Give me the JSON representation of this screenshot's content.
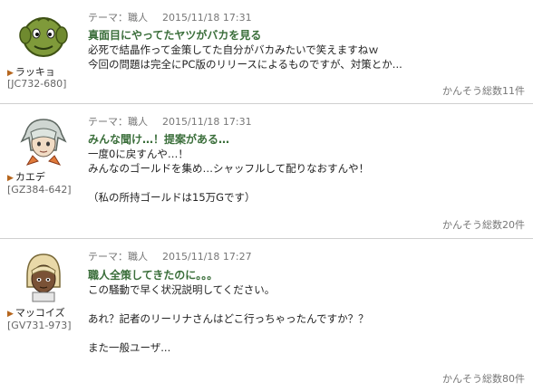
{
  "posts": [
    {
      "user": "ラッキョ",
      "user_id": "[JC732-680]",
      "theme": "テーマ：職人",
      "datetime": "2015/11/18 17:31",
      "title": "真面目にやってたヤツがバカを見る",
      "body": [
        "必死で結晶作って金策してた自分がバカみたいで笑えますねｗ",
        "今回の問題は完全にPC版のリリースによるものですが、対策とか..."
      ],
      "reply_count": "かんそう総数11件",
      "avatar_icon": "green-goblin-avatar-icon"
    },
    {
      "user": "カエデ",
      "user_id": "[GZ384-642]",
      "theme": "テーマ：職人",
      "datetime": "2015/11/18 17:31",
      "title": "みんな聞け…！提案がある…",
      "body": [
        "一度0に戻すんや…！",
        "みんなのゴールドを集め…シャッフルして配りなおすんや！",
        "",
        "（私の所持ゴールドは15万Gです）"
      ],
      "reply_count": "かんそう総数20件",
      "avatar_icon": "silver-hair-elf-avatar-icon"
    },
    {
      "user": "マッコイズ",
      "user_id": "[GV731-973]",
      "theme": "テーマ：職人",
      "datetime": "2015/11/18 17:27",
      "title": "職人全策してきたのに。。。",
      "body": [
        "この騒動で早く状況説明してください。",
        "",
        "あれ？記者のリーリナさんはどこ行っちゃったんですか？？",
        "",
        "また一般ユーザ..."
      ],
      "reply_count": "かんそう総数80件",
      "avatar_icon": "blonde-dark-skin-avatar-icon"
    }
  ]
}
